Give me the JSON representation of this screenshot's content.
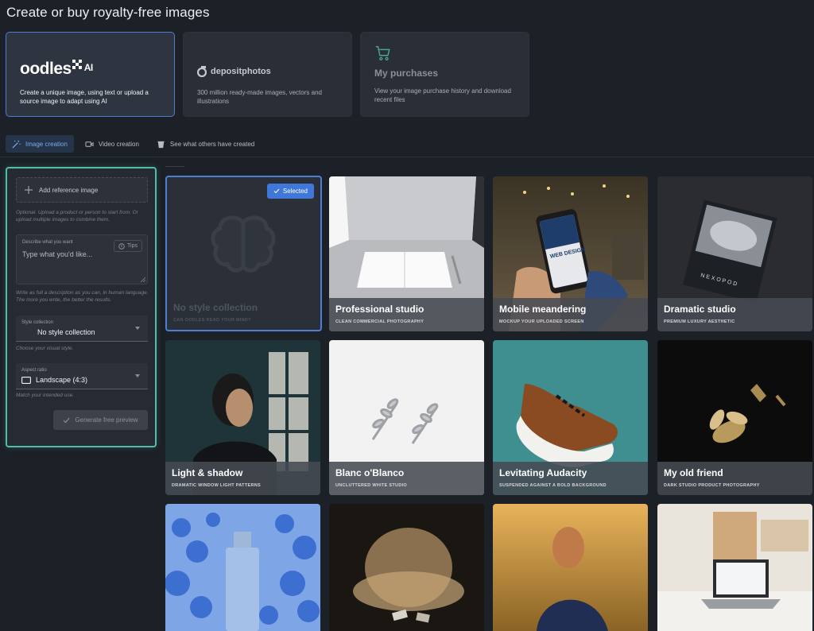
{
  "page_title": "Create or buy royalty-free images",
  "cards": [
    {
      "logo_text": "oodles",
      "logo_suffix": "AI",
      "desc": "Create a unique image, using text or upload a source image to adapt using AI"
    },
    {
      "logo_text": "depositphotos",
      "desc": "300 million ready-made images, vectors and illustrations"
    },
    {
      "title": "My purchases",
      "desc": "View your image purchase history and download recent files"
    }
  ],
  "tabs": [
    {
      "label": "Image creation"
    },
    {
      "label": "Video creation"
    },
    {
      "label": "See what others have created"
    }
  ],
  "panel": {
    "add_reference": "Add reference image",
    "reference_hint": "Optional. Upload a product or person to start from. Or upload multiple images to combine them.",
    "describe_label": "Describe what you want",
    "describe_placeholder": "Type what you'd like...",
    "tips_label": "Tips",
    "describe_hint": "Write as full a description as you can, in human language. The more you write, the better the results.",
    "style_label": "Style collection",
    "style_value": "No style collection",
    "style_hint": "Choose your visual style.",
    "aspect_label": "Aspect ratio",
    "aspect_value": "Landscape (4:3)",
    "aspect_hint": "Match your intended use.",
    "generate_label": "Generate free preview"
  },
  "tiles": [
    {
      "title": "No style collection",
      "subtitle": "CAN OODLES READ YOUR MIND?",
      "badge": "Selected"
    },
    {
      "title": "Professional studio",
      "subtitle": "CLEAN COMMERCIAL PHOTOGRAPHY"
    },
    {
      "title": "Mobile meandering",
      "subtitle": "MOCKUP YOUR UPLOADED SCREEN",
      "screen_text": "WEB DESIGN"
    },
    {
      "title": "Dramatic studio",
      "subtitle": "PREMIUM LUXURY AESTHETIC",
      "book_text": "NEXOPOD"
    },
    {
      "title": "Light & shadow",
      "subtitle": "DRAMATIC WINDOW LIGHT PATTERNS"
    },
    {
      "title": "Blanc o'Blanco",
      "subtitle": "UNCLUTTERED WHITE STUDIO"
    },
    {
      "title": "Levitating Audacity",
      "subtitle": "SUSPENDED AGAINST A BOLD BACKGROUND"
    },
    {
      "title": "My old friend",
      "subtitle": "DARK STUDIO PRODUCT PHOTOGRAPHY"
    },
    {
      "title": "",
      "subtitle": ""
    },
    {
      "title": "",
      "subtitle": ""
    },
    {
      "title": "",
      "subtitle": ""
    },
    {
      "title": "",
      "subtitle": ""
    }
  ],
  "colors": {
    "accent": "#3f78d8",
    "panel_glow": "#4dbfa8",
    "background": "#1c2027"
  },
  "icons": [
    "oodles-logo-icon",
    "depositphotos-logo-icon",
    "cart-icon",
    "magic-wand-icon",
    "video-icon",
    "bucket-icon",
    "plus-icon",
    "lightbulb-icon",
    "landscape-icon",
    "check-icon",
    "brain-icon"
  ]
}
